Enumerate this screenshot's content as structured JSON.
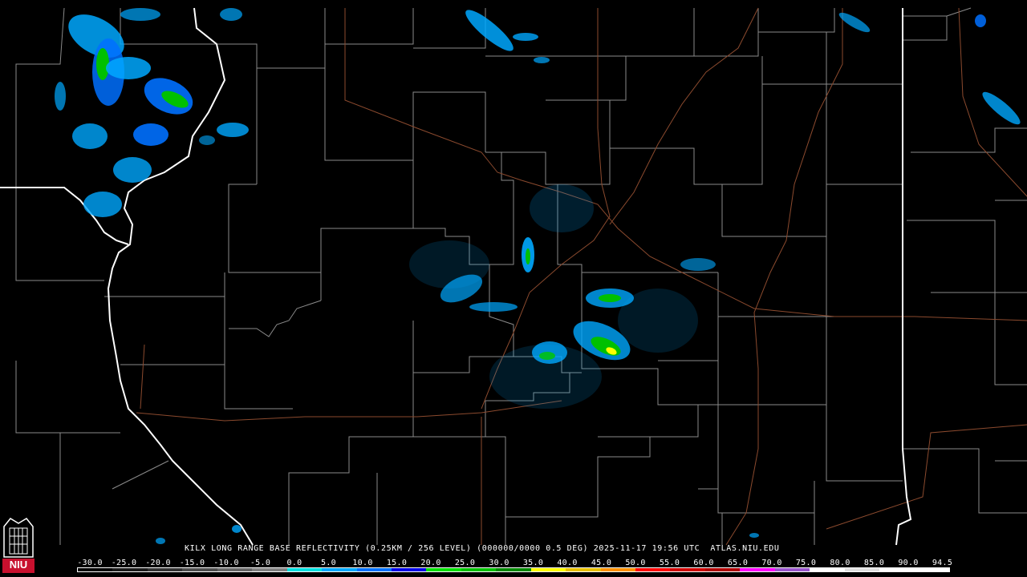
{
  "product": {
    "caption": "KILX LONG RANGE BASE REFLECTIVITY (0.25KM / 256 LEVEL) (000000/0000 0.5 DEG) 2025-11-17 19:56 UTC  ATLAS.NIU.EDU"
  },
  "logo": {
    "text": "NIU",
    "icon": "niu-logo-icon"
  },
  "colorscale": {
    "ticks": [
      "-30.0",
      "-25.0",
      "-20.0",
      "-15.0",
      "-10.0",
      "-5.0",
      "0.0",
      "5.0",
      "10.0",
      "15.0",
      "20.0",
      "25.0",
      "30.0",
      "35.0",
      "40.0",
      "45.0",
      "50.0",
      "55.0",
      "60.0",
      "65.0",
      "70.0",
      "75.0",
      "80.0",
      "85.0",
      "90.0",
      "94.5"
    ],
    "colors": [
      "#000000",
      "#1a1a1a",
      "#333333",
      "#4d4d4d",
      "#666666",
      "#808080",
      "#00e0e0",
      "#00a8ff",
      "#0070ff",
      "#0000e8",
      "#00e000",
      "#00c000",
      "#008800",
      "#ffff00",
      "#e8c000",
      "#ff9000",
      "#ff0000",
      "#d00000",
      "#b00000",
      "#ff00ff",
      "#9955cc",
      "#ffffff",
      "#e0e0e0",
      "#ffffff",
      "#ffffff"
    ]
  },
  "colors": {
    "background": "#000000",
    "county_lines": "#8a8a8a",
    "state_lines": "#ffffff",
    "highways": "#8b4a2e"
  }
}
